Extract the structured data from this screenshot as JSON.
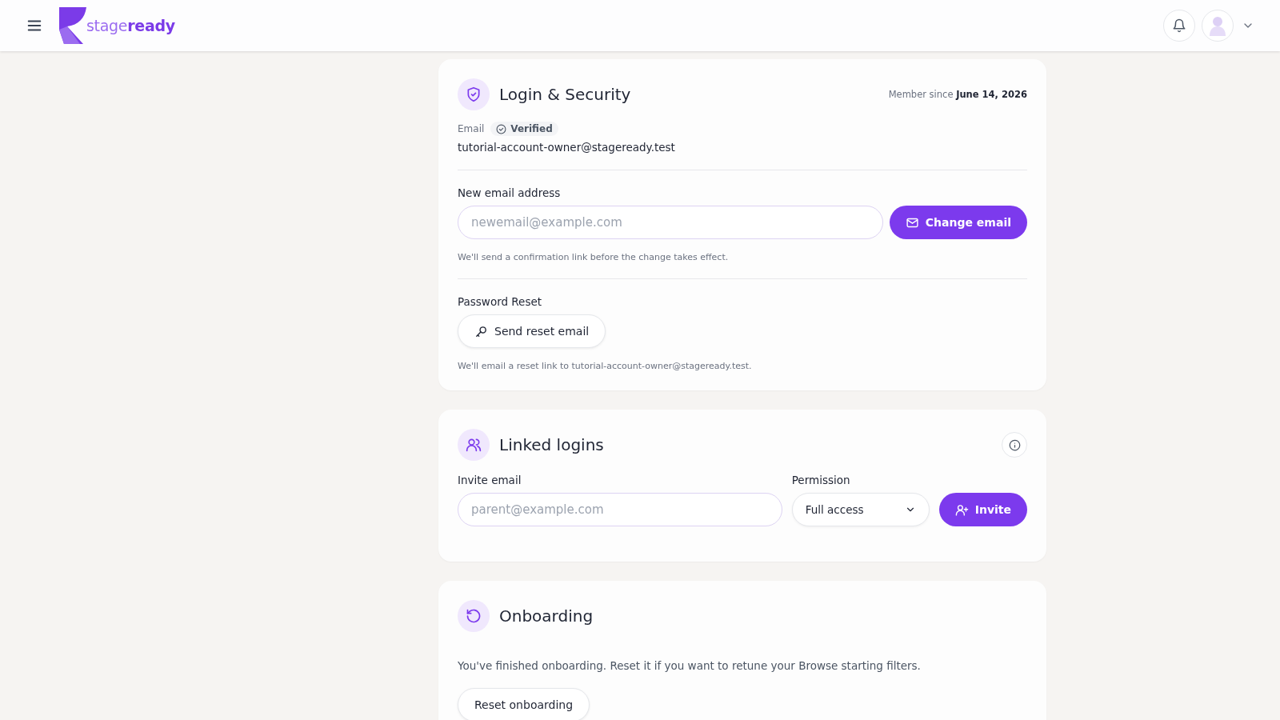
{
  "header": {
    "logo_parts": [
      "stage",
      "ready"
    ]
  },
  "security": {
    "title": "Login & Security",
    "member_since_label": "Member since",
    "member_since_date": "June 14, 2026",
    "email_label": "Email",
    "verified_badge": "Verified",
    "email": "tutorial-account-owner@stageready.test",
    "new_email_label": "New email address",
    "new_email_placeholder": "newemail@example.com",
    "change_button": "Change email",
    "change_hint": "We'll send a confirmation link before the change takes effect.",
    "password_label": "Password Reset",
    "reset_button": "Send reset email",
    "reset_hint": "We'll email a reset link to tutorial-account-owner@stageready.test."
  },
  "linked": {
    "title": "Linked logins",
    "invite_label": "Invite email",
    "invite_placeholder": "parent@example.com",
    "permission_label": "Permission",
    "permission_value": "Full access",
    "invite_button": "Invite"
  },
  "onboarding": {
    "title": "Onboarding",
    "text": "You've finished onboarding. Reset it if you want to retune your Browse starting filters.",
    "reset_button": "Reset onboarding"
  }
}
